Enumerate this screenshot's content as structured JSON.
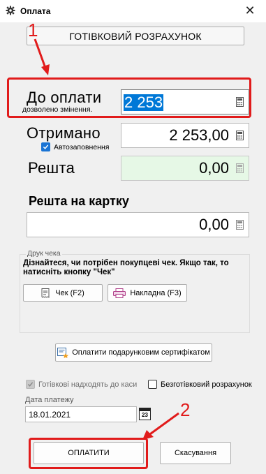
{
  "window": {
    "title": "Оплата",
    "close_symbol": "✕"
  },
  "cash_button": {
    "label": "ГОТІВКОВИЙ РОЗРАХУНОК"
  },
  "annotations": {
    "marker_1": "1",
    "marker_2": "2",
    "color": "#e11b1b"
  },
  "to_pay": {
    "label": "До оплати",
    "note": "дозволено змінення.",
    "value": "2 253"
  },
  "received": {
    "label": "Отримано",
    "value": "2 253,00",
    "autofill_label": "Автозаповнення",
    "autofill_checked": true
  },
  "change": {
    "label": "Решта",
    "value": "0,00"
  },
  "change_to_card": {
    "label": "Решта на картку",
    "value": "0,00"
  },
  "receipt_print": {
    "legend": "Друк чека",
    "hint": "Дізнайтеся, чи потрібен покупцеві чек. Якщо так, то натисніть кнопку \"Чек\"",
    "check_button": "Чек (F2)",
    "invoice_button": "Накладна (F3)"
  },
  "gift_certificate_button": "Оплатити подарунковим сертифікатом",
  "options": {
    "cash_to_register_label": "Готівкові надходять до каси",
    "cash_to_register_checked": true,
    "cashless_label": "Безготівковий розрахунок",
    "cashless_checked": false
  },
  "payment_date": {
    "label": "Дата платежу",
    "value": "18.01.2021",
    "calendar_day": "23"
  },
  "footer": {
    "pay_button": "ОПЛАТИТИ",
    "cancel_button": "Скасування"
  },
  "colors": {
    "selection": "#0078d7",
    "change_bg": "#e6f8e6",
    "accent_check": "#1a74d4"
  }
}
